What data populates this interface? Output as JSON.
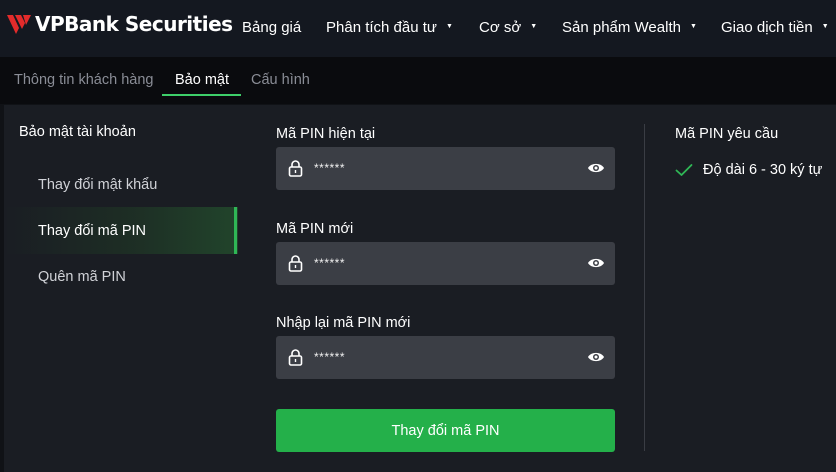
{
  "brand": {
    "name": "VPBank Securities",
    "accent": "#24b04a",
    "logo_color": "#e32b2b"
  },
  "nav": [
    {
      "label": "Bảng giá",
      "has_caret": false
    },
    {
      "label": "Phân tích đầu tư",
      "has_caret": true
    },
    {
      "label": "Cơ sở",
      "has_caret": true
    },
    {
      "label": "Sản phẩm Wealth",
      "has_caret": true
    },
    {
      "label": "Giao dịch tiền",
      "has_caret": true
    }
  ],
  "tabs": [
    {
      "label": "Thông tin khách hàng",
      "active": false
    },
    {
      "label": "Bảo mật",
      "active": true
    },
    {
      "label": "Cấu hình",
      "active": false
    }
  ],
  "sidebar": {
    "title": "Bảo mật tài khoản",
    "items": [
      {
        "label": "Thay đổi mật khẩu",
        "active": false
      },
      {
        "label": "Thay đổi mã PIN",
        "active": true
      },
      {
        "label": "Quên mã PIN",
        "active": false
      }
    ]
  },
  "form": {
    "fields": [
      {
        "label": "Mã PIN hiện tại",
        "value": "******",
        "lock_icon": "lock-icon",
        "eye_icon": "eye-icon"
      },
      {
        "label": "Mã PIN mới",
        "value": "******",
        "lock_icon": "lock-icon",
        "eye_icon": "eye-icon"
      },
      {
        "label": "Nhập lại mã PIN mới",
        "value": "******",
        "lock_icon": "lock-icon",
        "eye_icon": "eye-icon"
      }
    ],
    "submit_label": "Thay đổi mã PIN"
  },
  "requirements": {
    "title": "Mã PIN yêu cầu",
    "items": [
      {
        "label": "Độ dài 6 - 30 ký tự",
        "status": "satisfied",
        "icon": "check-icon"
      }
    ]
  }
}
